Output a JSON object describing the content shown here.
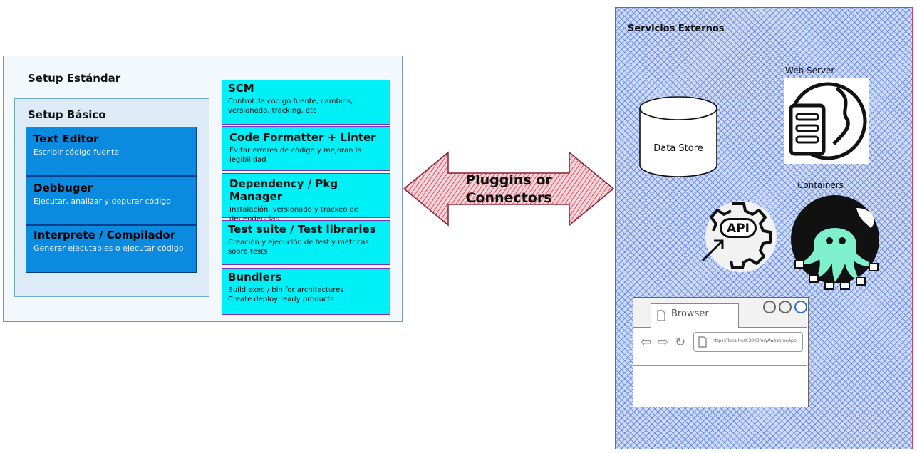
{
  "setup_estandar": {
    "title": "Setup Estándar"
  },
  "setup_basico": {
    "title": "Setup Básico",
    "cards": [
      {
        "heading": "Text Editor",
        "desc": "Escribir código fuente"
      },
      {
        "heading": "Debbuger",
        "desc": "Ejecutar, analizar y depurar código"
      },
      {
        "heading": "Interprete / Compilador",
        "desc": "Generar ejecutables o ejecutar código"
      }
    ]
  },
  "tools": [
    {
      "heading": "SCM",
      "desc": "Control de código fuente, cambios, versionado, tracking, etc"
    },
    {
      "heading": "Code Formatter + Linter",
      "desc": "Evitar errores de código y mejoran la legibilidad"
    },
    {
      "heading": "Dependency / Pkg Manager",
      "desc": "Instalación, versionado y trackeo de dependencias"
    },
    {
      "heading": "Test suite / Test libraries",
      "desc": "Creación y ejecución de test y métricas sobre tests"
    },
    {
      "heading": "Bundlers",
      "desc": "Build exec / bin for architectures\nCreate deploy ready products"
    }
  ],
  "arrow": {
    "line1": "Pluggins or",
    "line2": "Connectors"
  },
  "servicios": {
    "title": "Servicios Externos",
    "data_store": "Data Store",
    "web_server": "Web Server",
    "containers": "Containers",
    "api": "API",
    "browser": {
      "tab": "Browser",
      "url": "https://localhost:3000/myAwesomeApp"
    }
  },
  "colors": {
    "blue_card": "#0a8be0",
    "cyan_card": "#00f0f8",
    "arrow_red": "#c8344a",
    "hatch_blue": "#2850d2"
  }
}
